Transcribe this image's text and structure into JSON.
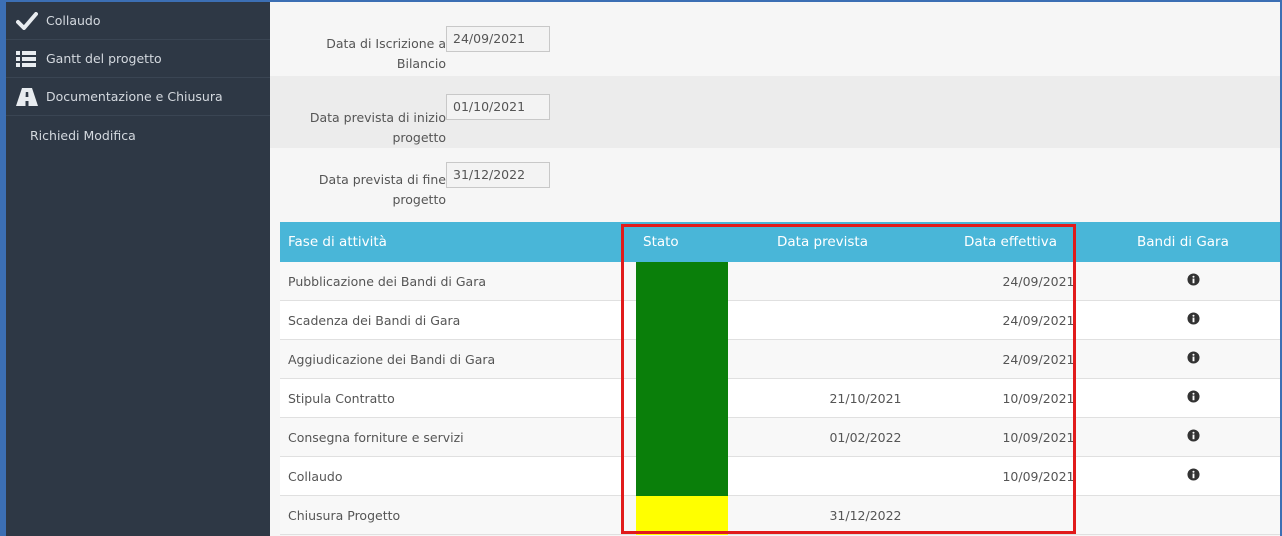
{
  "sidebar": {
    "items": [
      {
        "label": "Collaudo",
        "icon": "checkmark-icon"
      },
      {
        "label": "Gantt del progetto",
        "icon": "list-icon"
      },
      {
        "label": "Documentazione e Chiusura",
        "icon": "road-icon"
      },
      {
        "label": "Richiedi Modifica",
        "icon": ""
      }
    ]
  },
  "dates": [
    {
      "label_line1": "Data di Iscrizione a",
      "label_line2": "Bilancio",
      "value": "24/09/2021"
    },
    {
      "label_line1": "Data prevista di inizio",
      "label_line2": "progetto",
      "value": "01/10/2021"
    },
    {
      "label_line1": "Data prevista di fine",
      "label_line2": "progetto",
      "value": "31/12/2022"
    }
  ],
  "table": {
    "headers": [
      "Fase di attività",
      "Stato",
      "Data prevista",
      "Data effettiva",
      "Bandi di Gara"
    ],
    "rows": [
      {
        "fase": "Pubblicazione dei Bandi di Gara",
        "stato_color": "#0a7f0a",
        "prevista": "",
        "effettiva": "24/09/2021",
        "info": true
      },
      {
        "fase": "Scadenza dei Bandi di Gara",
        "stato_color": "#0a7f0a",
        "prevista": "",
        "effettiva": "24/09/2021",
        "info": true
      },
      {
        "fase": "Aggiudicazione dei Bandi di Gara",
        "stato_color": "#0a7f0a",
        "prevista": "",
        "effettiva": "24/09/2021",
        "info": true
      },
      {
        "fase": "Stipula Contratto",
        "stato_color": "#0a7f0a",
        "prevista": "21/10/2021",
        "effettiva": "10/09/2021",
        "info": true
      },
      {
        "fase": "Consegna forniture e servizi",
        "stato_color": "#0a7f0a",
        "prevista": "01/02/2022",
        "effettiva": "10/09/2021",
        "info": true
      },
      {
        "fase": "Collaudo",
        "stato_color": "#0a7f0a",
        "prevista": "",
        "effettiva": "10/09/2021",
        "info": true
      },
      {
        "fase": "Chiusura Progetto",
        "stato_color": "#ffff00",
        "prevista": "31/12/2022",
        "effettiva": "",
        "info": false
      }
    ]
  },
  "colors": {
    "sidebar_bg": "#2e3845",
    "header_bg": "#49b6d8",
    "status_green": "#0a7f0a",
    "status_yellow": "#ffff00",
    "highlight": "#e11b1b"
  }
}
